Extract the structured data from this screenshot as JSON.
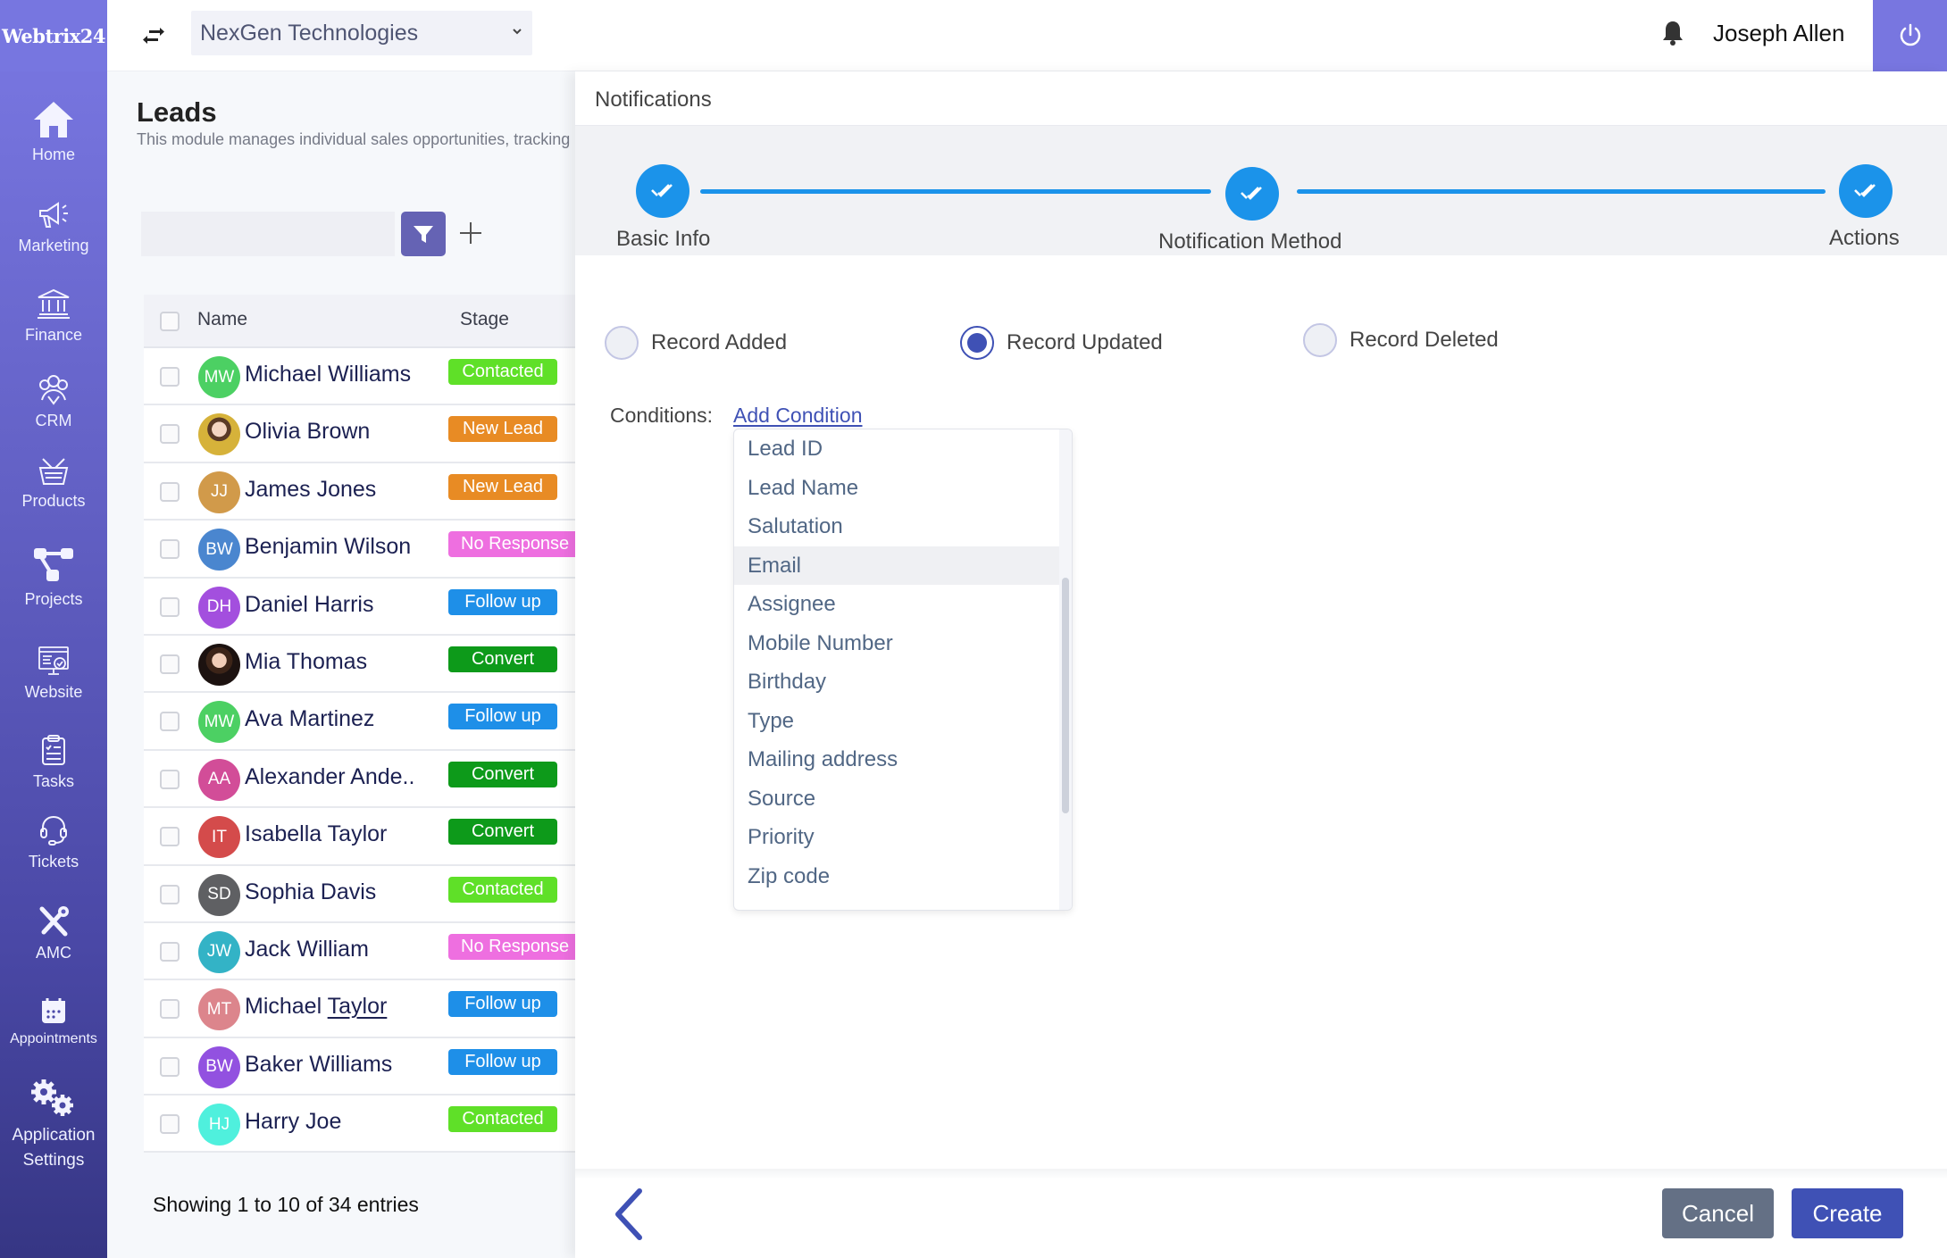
{
  "brand": {
    "logo_text": "Webtrix24",
    "accent": "#7776e0"
  },
  "sidebar": {
    "items": [
      {
        "label": "Home",
        "icon": "home-icon"
      },
      {
        "label": "Marketing",
        "icon": "megaphone-icon"
      },
      {
        "label": "Finance",
        "icon": "bank-icon"
      },
      {
        "label": "CRM",
        "icon": "users-icon"
      },
      {
        "label": "Products",
        "icon": "basket-icon"
      },
      {
        "label": "Projects",
        "icon": "project-nodes-icon"
      },
      {
        "label": "Website",
        "icon": "website-monitor-icon"
      },
      {
        "label": "Tasks",
        "icon": "clipboard-icon"
      },
      {
        "label": "Tickets",
        "icon": "headset-icon"
      },
      {
        "label": "AMC",
        "icon": "tools-icon"
      },
      {
        "label": "Appointments",
        "icon": "calendar-icon"
      },
      {
        "label_line1": "Application",
        "label_line2": "Settings",
        "icon": "gears-icon"
      }
    ]
  },
  "topbar": {
    "company": "NexGen Technologies",
    "user_name": "Joseph Allen"
  },
  "leads": {
    "title": "Leads",
    "subtitle": "This module manages individual sales opportunities, tracking",
    "search_placeholder": "",
    "columns": {
      "name": "Name",
      "stage": "Stage"
    },
    "rows": [
      {
        "initials": "MW",
        "name": "Michael Williams",
        "stage": "Contacted",
        "avatar_color": "#4cd063",
        "stage_color": "#5fe028"
      },
      {
        "initials": "",
        "name": "Olivia Brown",
        "stage": "New Lead",
        "avatar_color": "photo",
        "stage_color": "#e88b24"
      },
      {
        "initials": "JJ",
        "name": "James Jones",
        "stage": "New Lead",
        "avatar_color": "#d19a4a",
        "stage_color": "#e88b24"
      },
      {
        "initials": "BW",
        "name": "Benjamin Wilson",
        "stage": "No Response",
        "avatar_color": "#4a86cf",
        "stage_color": "#ee6fe0"
      },
      {
        "initials": "DH",
        "name": "Daniel Harris",
        "stage": "Follow up",
        "avatar_color": "#a34fde",
        "stage_color": "#1e8fe8"
      },
      {
        "initials": "",
        "name": "Mia Thomas",
        "stage": "Convert",
        "avatar_color": "photo2",
        "stage_color": "#0d9a1a"
      },
      {
        "initials": "MW",
        "name": "Ava Martinez",
        "stage": "Follow up",
        "avatar_color": "#4cd063",
        "stage_color": "#1e8fe8"
      },
      {
        "initials": "AA",
        "name": "Alexander Ande..",
        "stage": "Convert",
        "avatar_color": "#d24d98",
        "stage_color": "#0d9a1a"
      },
      {
        "initials": "IT",
        "name": "Isabella Taylor",
        "stage": "Convert",
        "avatar_color": "#d44b4b",
        "stage_color": "#0d9a1a"
      },
      {
        "initials": "SD",
        "name": "Sophia Davis",
        "stage": "Contacted",
        "avatar_color": "#5f6063",
        "stage_color": "#5fe028"
      },
      {
        "initials": "JW",
        "name": "Jack William",
        "stage": "No Response",
        "avatar_color": "#33b3c6",
        "stage_color": "#ee6fe0"
      },
      {
        "initials": "MT",
        "name_first": "Michael ",
        "name_last": "Taylor",
        "name": "Michael Taylor",
        "stage": "Follow up",
        "avatar_color": "#dc858c",
        "stage_color": "#1e8fe8"
      },
      {
        "initials": "BW",
        "name": "Baker Williams",
        "stage": "Follow up",
        "avatar_color": "#9251e0",
        "stage_color": "#1e8fe8"
      },
      {
        "initials": "HJ",
        "name": "Harry Joe",
        "stage": "Contacted",
        "avatar_color": "#4ff0dd",
        "stage_color": "#5fe028"
      }
    ],
    "entries_text": "Showing 1 to 10 of 34 entries"
  },
  "notifications": {
    "title": "Notifications",
    "steps": [
      {
        "label": "Basic Info",
        "completed": true
      },
      {
        "label": "Notification Method",
        "completed": true
      },
      {
        "label": "Actions",
        "completed": true
      }
    ],
    "triggers": [
      {
        "label": "Record Added",
        "checked": false
      },
      {
        "label": "Record Updated",
        "checked": true
      },
      {
        "label": "Record Deleted",
        "checked": false
      }
    ],
    "conditions_label": "Conditions:",
    "add_condition_label": "Add Condition",
    "condition_fields": [
      "Lead ID",
      "Lead Name",
      "Salutation",
      "Email",
      "Assignee",
      "Mobile Number",
      "Birthday",
      "Type",
      "Mailing address",
      "Source",
      "Priority",
      "Zip code"
    ],
    "highlighted_field": "Email",
    "cancel_label": "Cancel",
    "create_label": "Create"
  }
}
